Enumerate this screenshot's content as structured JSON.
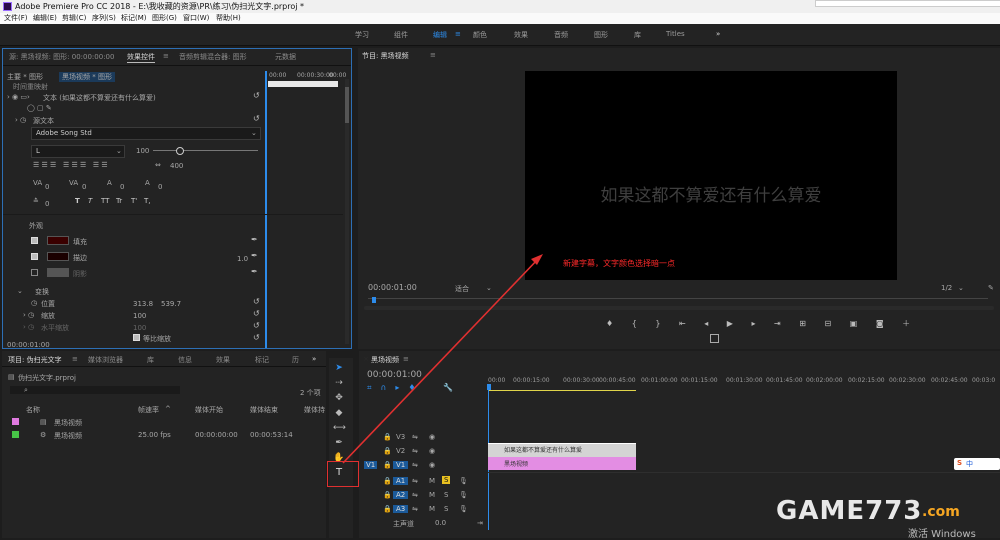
{
  "window": {
    "title": "Adobe Premiere Pro CC 2018 - E:\\我收藏的资源\\PR\\练习\\伪扫光文字.prproj *"
  },
  "menu": [
    "文件(F)",
    "编辑(E)",
    "剪辑(C)",
    "序列(S)",
    "标记(M)",
    "图形(G)",
    "窗口(W)",
    "帮助(H)"
  ],
  "workspaces": [
    "学习",
    "组件",
    "编辑",
    "颜色",
    "效果",
    "音频",
    "图形",
    "库",
    "Titles"
  ],
  "workspace_more": "»",
  "effects_panel": {
    "tabs": [
      "源: 黑场视频: 图形: 00:00:00:00",
      "效果控件",
      "音频剪辑混合器: 图形",
      "元数据"
    ],
    "menu_icon": "≡",
    "crumb_main": "主要 * 图形",
    "crumb_clip": "黑场视频 * 图形",
    "ruler_time_a": "00:00",
    "ruler_time_b": "00:00:30:00",
    "ruler_time_c": "00:00",
    "group_video": "时间重映射",
    "text_layer": "文本 (如果这都不算爱还有什么算爱)",
    "source_text": "源文本",
    "font": "Adobe Song Std",
    "font_style": "L",
    "font_size": "100",
    "tracking": "400",
    "v0": "0",
    "v1": "0",
    "v2": "0",
    "v3": "0",
    "v4": "0",
    "styles": [
      "T",
      "T",
      "TT",
      "Tr",
      "T'",
      "T,"
    ],
    "appearance": "外观",
    "fill": "填充",
    "stroke": "描边",
    "stroke_width": "1.0",
    "shadow": "阴影",
    "transform": "变换",
    "position": "位置",
    "pos_x": "313.8",
    "pos_y": "539.7",
    "scale": "缩放",
    "scale_val": "100",
    "scale_w": "水平缩放",
    "scale_w_val": "100",
    "uniform": "等比缩放",
    "time": "00:00:01:00"
  },
  "program_monitor": {
    "title": "节目: 黑场视频",
    "menu_icon": "≡",
    "text": "如果这都不算爱还有什么算爱",
    "timecode": "00:00:01:00",
    "fit": "适合",
    "quality": "1/2",
    "controls": [
      "marker-icon",
      "in-point-icon",
      "out-point-icon",
      "go-to-in-icon",
      "step-back-icon",
      "play-icon",
      "step-forward-icon",
      "go-to-out-icon",
      "insert-icon",
      "overwrite-icon",
      "export-frame-icon",
      "camera-icon",
      "plus-icon"
    ]
  },
  "annotation": {
    "text": "新建字幕，文字颜色选择暗一点",
    "color": "#ff2a2a"
  },
  "project_panel": {
    "tabs": [
      "项目: 伪扫光文字",
      "媒体浏览器",
      "库",
      "信息",
      "效果",
      "标记",
      "历"
    ],
    "more": "»",
    "file": "伪扫光文字.prproj",
    "item_count": "2 个项",
    "columns": [
      "名称",
      "帧速率",
      "媒体开始",
      "媒体结束",
      "媒体持"
    ],
    "items": [
      {
        "color": "#e07ae0",
        "name": "黑场视频",
        "fps": "",
        "start": "",
        "end": ""
      },
      {
        "color": "#47c447",
        "name": "黑场视频",
        "fps": "25.00 fps",
        "start": "00:00:00:00",
        "end": "00:00:53:14"
      }
    ]
  },
  "timeline": {
    "tab": "黑场视频",
    "menu_icon": "≡",
    "timecode": "00:00:01:00",
    "ruler": [
      "00:00",
      "00:00:15:00",
      "00:00:30:00",
      "00:00:45:00",
      "00:01:00:00",
      "00:01:15:00",
      "00:01:30:00",
      "00:01:45:00",
      "00:02:00:00",
      "00:02:15:00",
      "00:02:30:00",
      "00:02:45:00",
      "00:03:0"
    ],
    "video_tracks": [
      "V3",
      "V2",
      "V1"
    ],
    "audio_tracks": [
      "A1",
      "A2",
      "A3"
    ],
    "master": "主声道",
    "master_val": "0.0",
    "source_patch": "V1",
    "m": "M",
    "s": "S",
    "clip_title": "如果这都不算爱还有什么算爱",
    "clip_black": "黑场视频"
  },
  "tools": [
    "selection-icon",
    "track-select-icon",
    "ripple-edit-icon",
    "razor-icon",
    "slip-icon",
    "pen-icon",
    "hand-icon",
    "type-icon"
  ],
  "type_tool_label": "T",
  "watermark": {
    "brand": "GAME773",
    "suffix": ".com",
    "activate": "激活 Windows"
  },
  "ime": {
    "label": "中"
  }
}
